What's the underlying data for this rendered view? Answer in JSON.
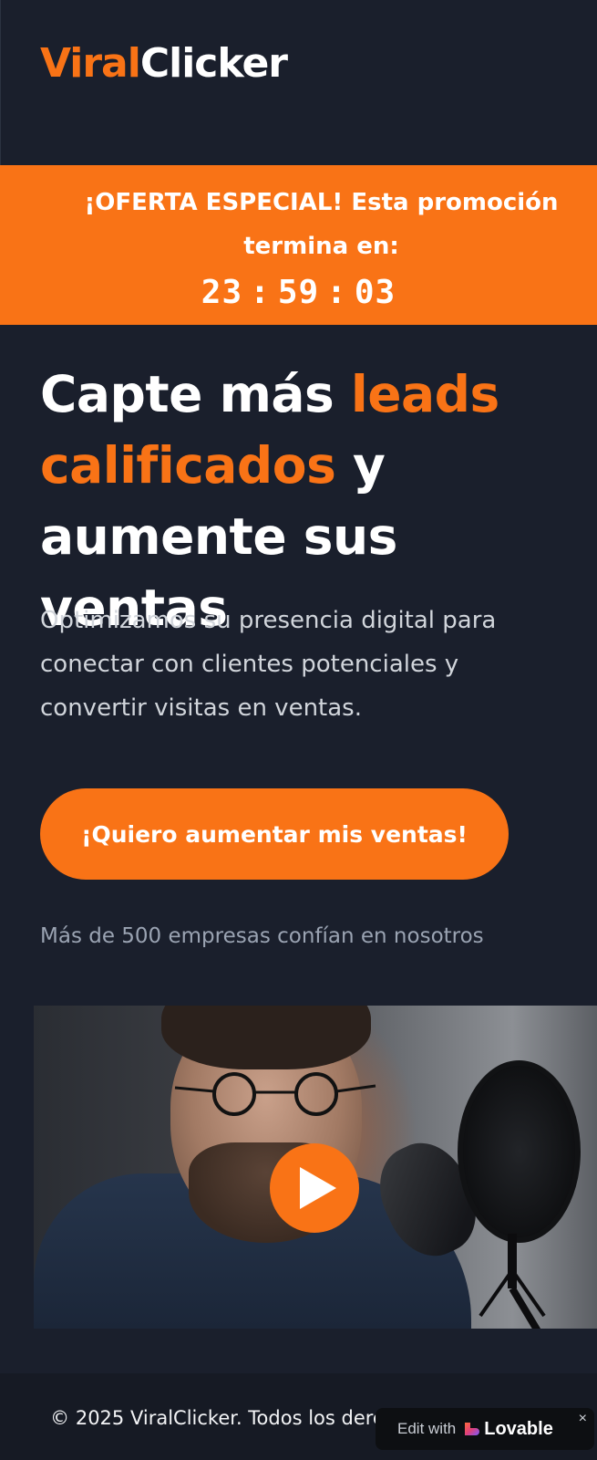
{
  "header": {
    "logo_part1": "Viral",
    "logo_part2": "Clicker"
  },
  "promo": {
    "text": "¡OFERTA ESPECIAL! Esta promoción termina en:",
    "timer": {
      "hours": "23",
      "minutes": "59",
      "seconds": "03",
      "separator": ":"
    }
  },
  "hero": {
    "title_1": "Capte más ",
    "title_accent_1": "leads calificados",
    "title_2": " y aumente sus ventas",
    "subtitle": "Optimizamos su presencia digital para conectar con clientes potenciales y convertir visitas en ventas.",
    "cta_label": "¡Quiero aumentar mis ventas!",
    "trust_text": "Más de 500 empresas confían en nosotros"
  },
  "video": {
    "play_icon": "play-icon"
  },
  "footer": {
    "copyright": "© 2025 ViralClicker. Todos los derechos reservados."
  },
  "badge": {
    "edit_with": "Edit with",
    "brand": "Lovable",
    "close": "×"
  },
  "colors": {
    "background": "#1a1f2c",
    "accent": "#f97316",
    "text": "#ffffff",
    "muted": "#9aa3b2"
  }
}
